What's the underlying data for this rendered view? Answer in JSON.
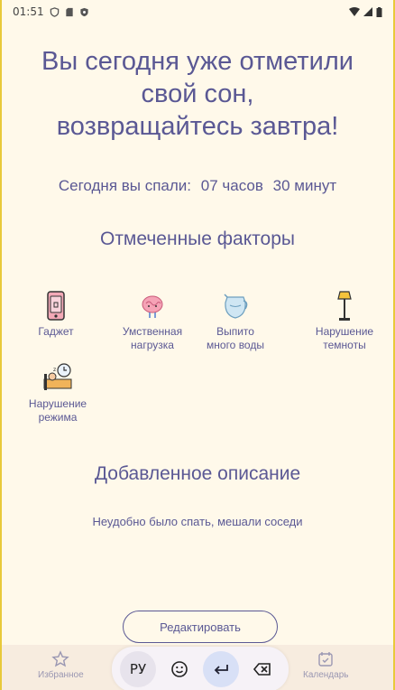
{
  "status": {
    "time": "01:51"
  },
  "headline": [
    "Вы сегодня уже отметили",
    "свой сон,",
    "возвращайтесь завтра!"
  ],
  "slept": {
    "label": "Сегодня вы спали:",
    "hours": "07 часов",
    "minutes": "30 минут"
  },
  "factors_title": "Отмеченные факторы",
  "factors": [
    {
      "label": [
        "Гаджет"
      ],
      "icon": "phone-icon"
    },
    {
      "label": [
        "Умственная",
        "нагрузка"
      ],
      "icon": "brain-icon"
    },
    {
      "label": [
        "Выпито",
        "много воды"
      ],
      "icon": "water-jug-icon"
    },
    {
      "label": [
        "Нарушение",
        "темноты"
      ],
      "icon": "floor-lamp-icon"
    },
    {
      "label": [
        "Нарушение",
        "режима"
      ],
      "icon": "sleep-schedule-icon"
    }
  ],
  "description_title": "Добавленное описание",
  "description_text": "Неудобно было спать, мешали соседи",
  "edit_button": "Редактировать",
  "nav": {
    "favorites": "Избранное",
    "calendar": "Календарь"
  },
  "keyboard": {
    "lang": "РУ"
  },
  "colors": {
    "background": "#fff9ea",
    "text": "#5a5894",
    "frame": "#e8c93a"
  }
}
